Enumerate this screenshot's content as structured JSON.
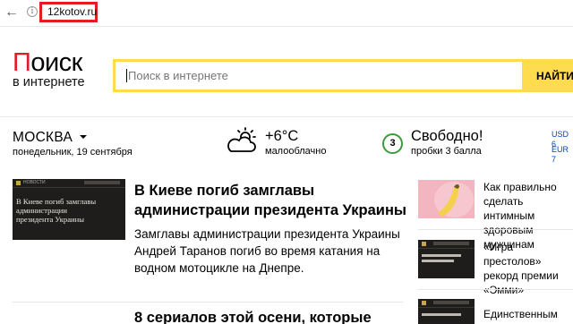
{
  "browser": {
    "url": "12kotov.ru",
    "back_icon": "back-arrow-icon",
    "info_icon": "info-icon"
  },
  "logo": {
    "first_letter": "П",
    "rest": "оиск",
    "subtitle": "в интернете"
  },
  "search": {
    "placeholder": "Поиск в интернете",
    "button_label": "НАЙТИ"
  },
  "location": {
    "city": "МОСКВА",
    "date": "понедельник, 19 сентября"
  },
  "weather": {
    "icon": "sun-cloud-icon",
    "temperature": "+6°C",
    "condition": "малооблачно"
  },
  "traffic": {
    "score": "3",
    "title": "Свободно!",
    "subtitle": "пробки 3 балла"
  },
  "currency": {
    "usd_label": "USD",
    "usd_value": "6",
    "eur_label": "EUR",
    "eur_value": "7"
  },
  "news": {
    "main": [
      {
        "title": "В Киеве погиб замглавы администрации президента Украины",
        "lead": "Замглавы администрации президента Украины Андрей Таранов погиб во время катания на водном мотоцикле на Днепре.",
        "thumb_header": "НОВОСТИ",
        "thumb_title": "В Киеве погиб замглавы администрации президента Украины"
      },
      {
        "title": "8 сериалов этой осени, которые"
      }
    ],
    "side": [
      {
        "text": "Как правильно сделать интимным здоровым мужчинам"
      },
      {
        "text": "«Игра престолов» рекорд премии «Эмми»"
      },
      {
        "text": "Единственным"
      }
    ]
  },
  "colors": {
    "logo_red": "#e31c23",
    "search_yellow": "#ffdb4d",
    "traffic_green": "#3c9b3c",
    "currency_blue": "#0044bb"
  }
}
